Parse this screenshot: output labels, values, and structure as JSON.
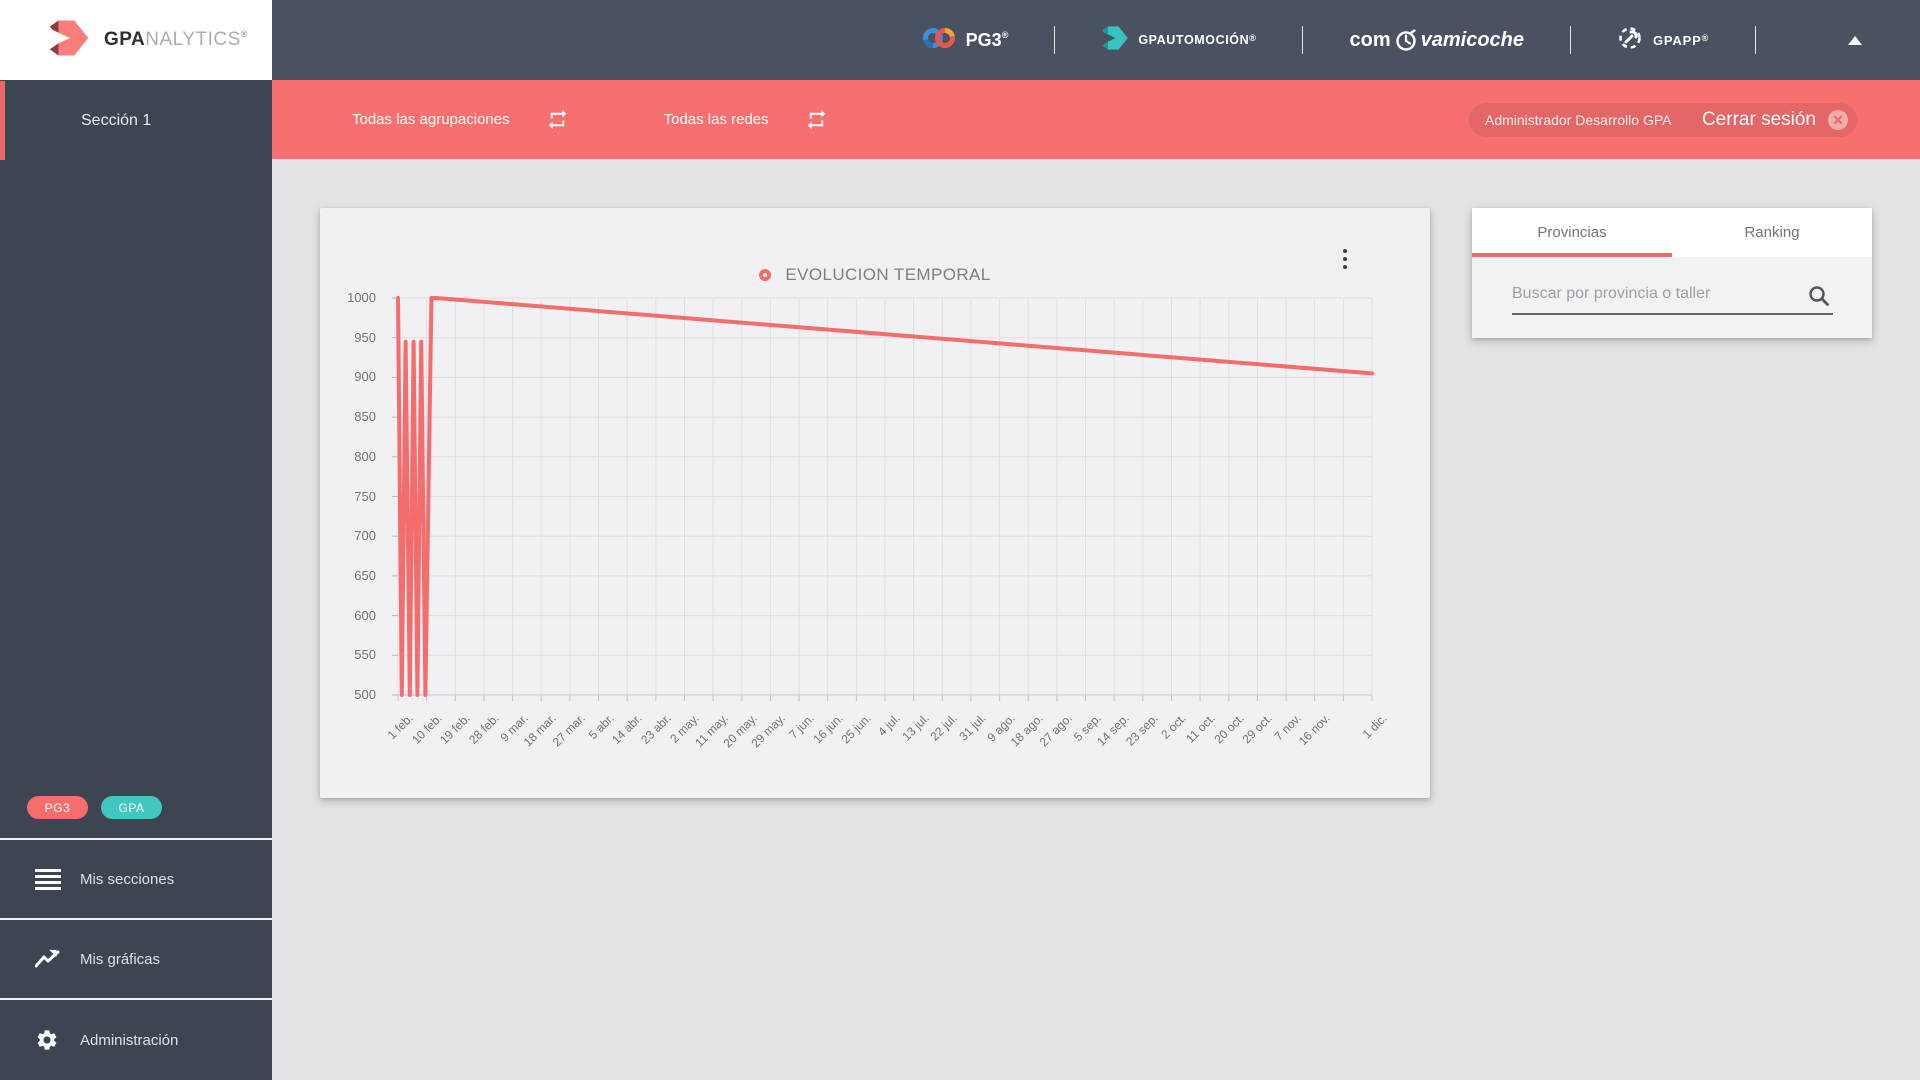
{
  "sidebar": {
    "logo": {
      "bold": "GPA",
      "light": "NALYTICS",
      "reg": "®"
    },
    "section": {
      "label": "Sección 1"
    },
    "badges": [
      {
        "label": "PG3",
        "color": "#f66d6d"
      },
      {
        "label": "GPA",
        "color": "#41c7c0"
      }
    ],
    "menu": [
      {
        "label": "Mis secciones",
        "icon": "list-icon"
      },
      {
        "label": "Mis gráficas",
        "icon": "chart-line-icon"
      },
      {
        "label": "Administración",
        "icon": "gear-icon"
      }
    ]
  },
  "header": {
    "brand_pg3": {
      "text": "PG3",
      "sup": "®"
    },
    "brand_gpautomocion": {
      "text": "GPAUTOMOCIÓN",
      "sup": "®"
    },
    "brand_comprovamicoche": {
      "pre": "com",
      "post": "vamicoche"
    },
    "brand_gpapp": {
      "text": "GPAPP",
      "sup": "®"
    }
  },
  "filter_bar": {
    "filters": [
      {
        "label": "Todas las agrupaciones"
      },
      {
        "label": "Todas las redes"
      }
    ],
    "user": "Administrador Desarrollo GPA",
    "logout_label": "Cerrar sesión",
    "logout_x": "✕"
  },
  "panel": {
    "tabs": [
      {
        "label": "Provincias",
        "active": true
      },
      {
        "label": "Ranking",
        "active": false
      }
    ],
    "search_placeholder": "Buscar por provincia o taller"
  },
  "chart_data": {
    "type": "line",
    "title": "EVOLUCION TEMPORAL",
    "legend": [
      {
        "label": "EVOLUCION TEMPORAL",
        "color": "#f56c6c"
      }
    ],
    "legend_position": "top-center",
    "grid": true,
    "ylim": [
      500,
      1000
    ],
    "y_ticks": [
      1000,
      950,
      900,
      850,
      800,
      750,
      700,
      650,
      600,
      550,
      500
    ],
    "x_tick_interval_days": 9,
    "x_tick_labels": [
      "1 feb.",
      "10 feb.",
      "19 feb.",
      "28 feb.",
      "9 mar.",
      "18 mar.",
      "27 mar.",
      "5 abr.",
      "14 abr.",
      "23 abr.",
      "2 may.",
      "11 may.",
      "20 may.",
      "29 may.",
      "7 jun.",
      "16 jun.",
      "25 jun.",
      "4 jul.",
      "13 jul.",
      "22 jul.",
      "31 jul.",
      "9 ago.",
      "18 ago.",
      "27 ago.",
      "5 sep.",
      "14 sep.",
      "23 sep.",
      "2 oct.",
      "11 oct.",
      "20 oct.",
      "29 oct.",
      "7 nov.",
      "16 nov.",
      "",
      "1 dic."
    ],
    "series": [
      {
        "name": "EVOLUCION TEMPORAL",
        "color": "#f56c6c",
        "points_days_value": [
          [
            0,
            1000
          ],
          [
            1.2,
            500
          ],
          [
            2.4,
            945
          ],
          [
            3.7,
            500
          ],
          [
            4.9,
            945
          ],
          [
            6.1,
            500
          ],
          [
            7.3,
            945
          ],
          [
            8.6,
            500
          ],
          [
            10.5,
            1000
          ],
          [
            12,
            1000
          ],
          [
            306,
            905
          ]
        ]
      }
    ]
  },
  "colors": {
    "accent_red": "#f86f6f",
    "line_red": "#f56c6c",
    "teal": "#41c7c0",
    "header_dark": "#4a5160",
    "sidebar_dark": "#3c4653"
  }
}
